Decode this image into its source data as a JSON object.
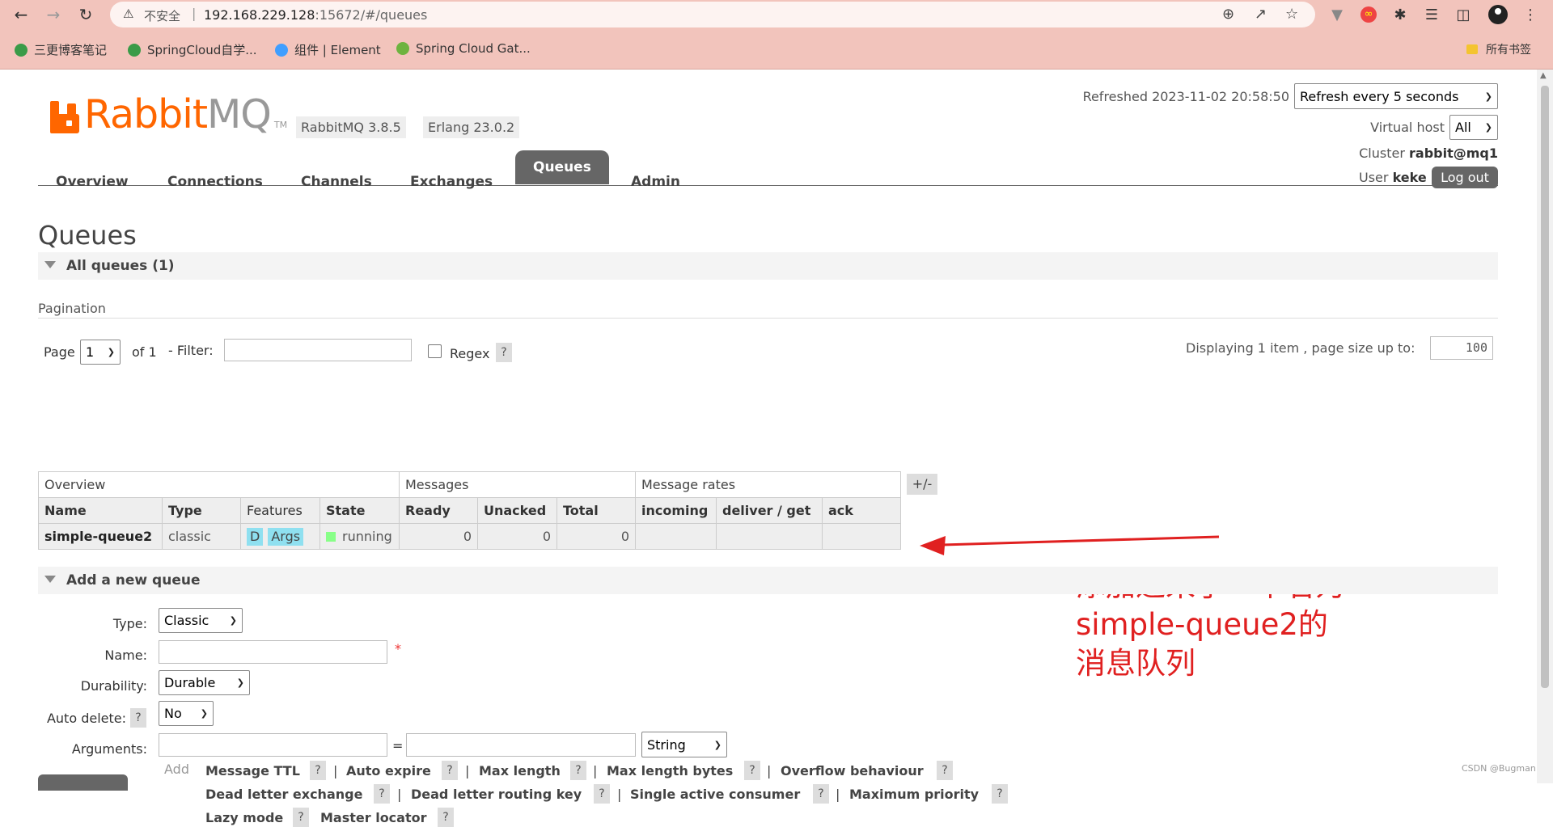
{
  "browser": {
    "insecure_label": "不安全",
    "url_host": "192.168.229.128",
    "url_rest": ":15672/#/queues",
    "bookmarks": [
      "三更博客笔记",
      "SpringCloud自学...",
      "组件 | Element",
      "Spring Cloud Gat..."
    ],
    "bookmarks_right": "所有书签"
  },
  "header": {
    "logo_main": "Rabbit",
    "logo_mq": "MQ",
    "logo_tm": "TM",
    "rabbitmq_version": "RabbitMQ 3.8.5",
    "erlang_version": "Erlang 23.0.2",
    "refreshed_label": "Refreshed 2023-11-02 20:58:50",
    "refresh_select": "Refresh every 5 seconds",
    "vhost_label": "Virtual host",
    "vhost_select": "All",
    "cluster_label": "Cluster",
    "cluster_value": "rabbit@mq1",
    "user_label": "User",
    "user_value": "keke",
    "logout_label": "Log out"
  },
  "tabs": [
    {
      "label": "Overview",
      "active": false
    },
    {
      "label": "Connections",
      "active": false
    },
    {
      "label": "Channels",
      "active": false
    },
    {
      "label": "Exchanges",
      "active": false
    },
    {
      "label": "Queues",
      "active": true
    },
    {
      "label": "Admin",
      "active": false
    }
  ],
  "page_title": "Queues",
  "all_queues_section": "All queues (1)",
  "pagination": {
    "label": "Pagination",
    "page_label": "Page",
    "page_value": "1",
    "of_label": "of 1",
    "filter_label": "- Filter:",
    "filter_value": "",
    "regex_label": "Regex",
    "help": "?",
    "displaying_label": "Displaying 1 item , page size up to:",
    "page_size": "100"
  },
  "table": {
    "groups": [
      "Overview",
      "Messages",
      "Message rates"
    ],
    "columns": [
      "Name",
      "Type",
      "Features",
      "State",
      "Ready",
      "Unacked",
      "Total",
      "incoming",
      "deliver / get",
      "ack"
    ],
    "toggle_label": "+/-",
    "rows": [
      {
        "name": "simple-queue2",
        "type": "classic",
        "features": [
          "D",
          "Args"
        ],
        "state": "running",
        "ready": "0",
        "unacked": "0",
        "total": "0",
        "incoming": "",
        "deliver_get": "",
        "ack": ""
      }
    ]
  },
  "annotation": {
    "lines": [
      "添加进来了一个名为",
      "simple-queue2的",
      "消息队列"
    ],
    "color": "#e02020"
  },
  "add_queue": {
    "section_label": "Add a new queue",
    "type_label": "Type:",
    "type_value": "Classic",
    "name_label": "Name:",
    "name_value": "",
    "required_mark": "*",
    "durability_label": "Durability:",
    "durability_value": "Durable",
    "auto_delete_label": "Auto delete:",
    "auto_delete_value": "No",
    "arguments_label": "Arguments:",
    "equals": "=",
    "arg_type_value": "String",
    "add_label": "Add",
    "arg_links": [
      "Message TTL",
      "Auto expire",
      "Max length",
      "Max length bytes",
      "Overflow behaviour",
      "Dead letter exchange",
      "Dead letter routing key",
      "Single active consumer",
      "Maximum priority",
      "Lazy mode",
      "Master locator"
    ]
  },
  "watermark": "CSDN @Bugman",
  "colors": {
    "brand": "#ff6600",
    "tab_active": "#666666",
    "chrome_bg": "#f2c4bc"
  }
}
